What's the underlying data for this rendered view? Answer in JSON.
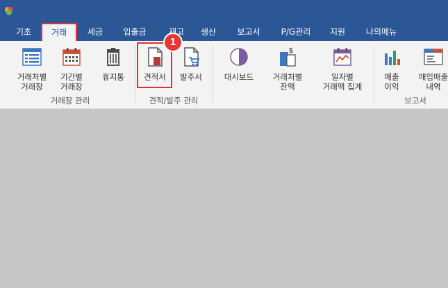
{
  "menu": {
    "items": [
      "기초",
      "거래",
      "세금",
      "입출금",
      "재고",
      "생산",
      "보고서",
      "P/G관리",
      "지원",
      "나의메뉴"
    ],
    "active": "거래"
  },
  "ribbon": {
    "buttons": {
      "trade_by_partner": "거래처별\n거래장",
      "trade_by_period": "기간별\n거래장",
      "trash": "휴지통",
      "quote": "견적서",
      "purchase_order": "발주서",
      "dashboard": "대시보드",
      "balance_by_partner": "거래처별\n잔액",
      "daily_trade_total": "일자별\n거래액 집계",
      "sales_profit": "매출\n이익",
      "purchase_sales_detail": "매입매출\n내역"
    },
    "groups": {
      "ledger_mgmt": "거래장 관리",
      "quote_order_mgmt": "견적/발주 관리",
      "reports": "보고서"
    }
  },
  "callout": {
    "step": "1"
  },
  "icons": {
    "app": "app-logo-icon",
    "ledger": "ledger-list-icon",
    "calendar": "calendar-icon",
    "trash": "trash-icon",
    "document": "document-icon",
    "cart_doc": "cart-document-icon",
    "pie": "pie-chart-icon",
    "dollar_doc": "dollar-document-icon",
    "line_chart": "line-chart-icon",
    "bar_chart": "bar-chart-icon",
    "window": "window-list-icon"
  },
  "colors": {
    "titlebar": "#2b5797",
    "highlight": "#e03030",
    "ribbon": "#f3f3f3"
  }
}
